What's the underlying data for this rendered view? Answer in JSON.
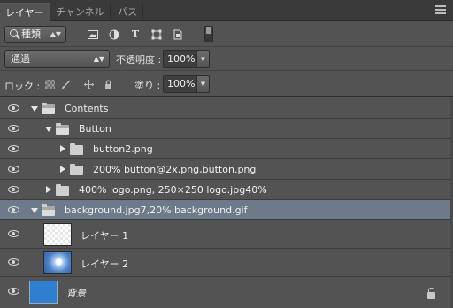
{
  "tabs": [
    {
      "label": "レイヤー",
      "active": true
    },
    {
      "label": "チャンネル",
      "active": false
    },
    {
      "label": "パス",
      "active": false
    }
  ],
  "filter": {
    "kind_label": "種類",
    "icons": [
      "image-filter-icon",
      "adjustment-filter-icon",
      "type-filter-icon",
      "shape-filter-icon",
      "smart-object-filter-icon"
    ],
    "type_glyph": "T"
  },
  "blend": {
    "mode": "通過",
    "opacity_label": "不透明度 :",
    "opacity_value": "100%"
  },
  "lock": {
    "label": "ロック :",
    "fill_label": "塗り :",
    "fill_value": "100%"
  },
  "layers": [
    {
      "name": "Contents",
      "kind": "group",
      "expanded": true,
      "indent": 0,
      "selected": false
    },
    {
      "name": "Button",
      "kind": "group",
      "expanded": true,
      "indent": 1,
      "selected": false
    },
    {
      "name": "button2.png",
      "kind": "group",
      "expanded": false,
      "indent": 2,
      "selected": false
    },
    {
      "name": "200% button@2x.png,button.png",
      "kind": "group",
      "expanded": false,
      "indent": 2,
      "selected": false
    },
    {
      "name": "400% logo.png, 250×250 logo.jpg40%",
      "kind": "group",
      "expanded": false,
      "indent": 1,
      "selected": false
    },
    {
      "name": "background.jpg7,20% background.gif",
      "kind": "group",
      "expanded": true,
      "indent": 0,
      "selected": true
    },
    {
      "name": "レイヤー 1",
      "kind": "layer",
      "thumb": "transparent",
      "selected": false
    },
    {
      "name": "レイヤー 2",
      "kind": "layer",
      "thumb": "sky",
      "selected": false
    },
    {
      "name": "背景",
      "kind": "background",
      "thumb": "blue",
      "locked": true,
      "selected": false
    }
  ],
  "colors": {
    "panel_bg": "#535353",
    "tab_bar": "#3a3a3a",
    "selected_row": "#6c7a8a",
    "background_fill": "#2f7fd0"
  }
}
